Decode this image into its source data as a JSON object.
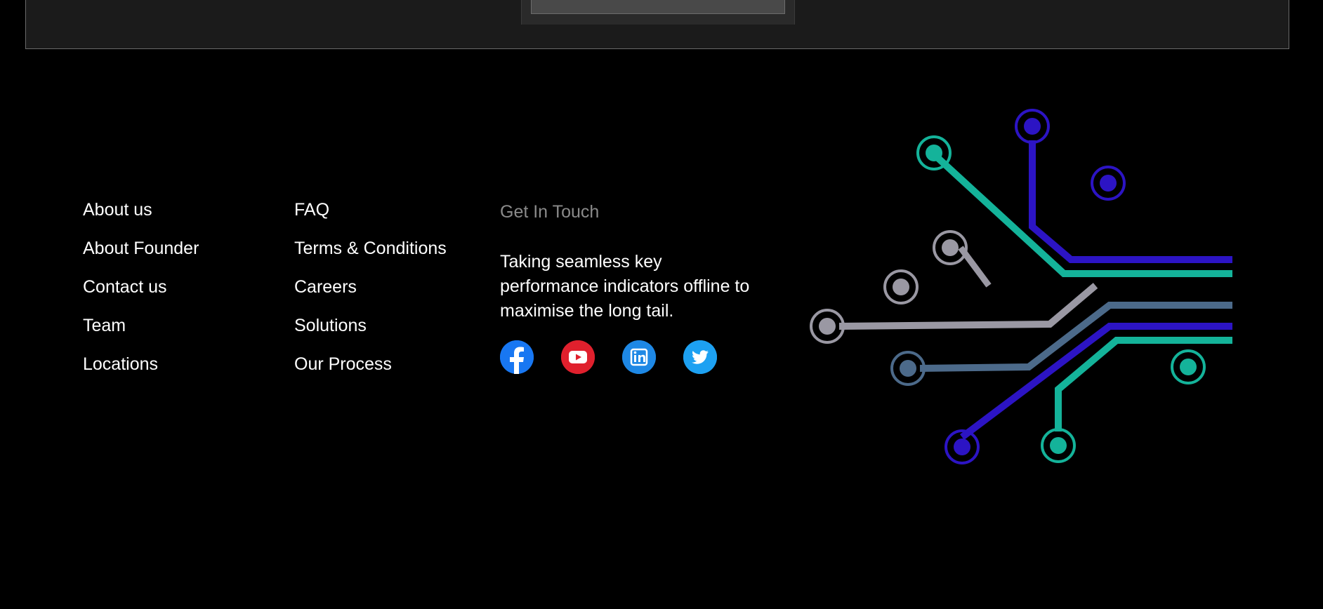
{
  "footer": {
    "column_one": [
      {
        "label": "About us"
      },
      {
        "label": "About Founder"
      },
      {
        "label": "Contact us"
      },
      {
        "label": "Team"
      },
      {
        "label": "Locations"
      }
    ],
    "column_two": [
      {
        "label": "FAQ"
      },
      {
        "label": "Terms & Conditions"
      },
      {
        "label": "Careers"
      },
      {
        "label": "Solutions"
      },
      {
        "label": "Our Process"
      }
    ],
    "contact": {
      "heading": "Get In Touch",
      "text": "Taking seamless key performance indicators offline to maximise the long tail."
    },
    "social": [
      {
        "icon": "facebook-icon",
        "color": "#1877f2"
      },
      {
        "icon": "youtube-icon",
        "color": "#e0202d"
      },
      {
        "icon": "linkedin-icon",
        "color": "#1e88e5"
      },
      {
        "icon": "twitter-icon",
        "color": "#1da1f2"
      }
    ]
  },
  "colors": {
    "background": "#000000",
    "panel": "#1b1b1b",
    "heading_muted": "#8a8a8a",
    "circuit_teal": "#14b39a",
    "circuit_indigo": "#2c14c4",
    "circuit_gray": "#9a98a3",
    "circuit_slate": "#4c6a8a"
  }
}
